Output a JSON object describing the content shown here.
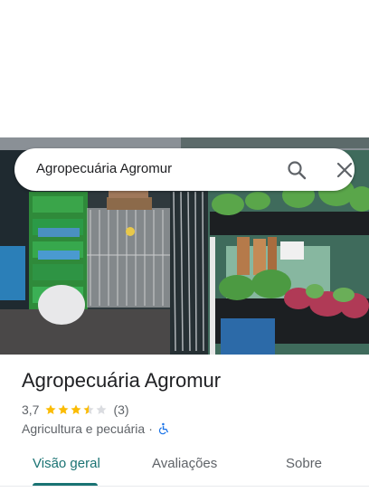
{
  "search": {
    "query": "Agropecuária Agromur"
  },
  "place": {
    "name": "Agropecuária Agromur",
    "rating": "3,7",
    "rating_value": 3.7,
    "review_count": "(3)",
    "category": "Agricultura e pecuária",
    "separator": "·"
  },
  "tabs": [
    {
      "label": "Visão geral"
    },
    {
      "label": "Avaliações"
    },
    {
      "label": "Sobre"
    }
  ],
  "colors": {
    "accent": "#1a7373",
    "star": "#fbbc04",
    "star_empty": "#dadce0",
    "accessibility": "#1a73e8"
  },
  "icons": {
    "search": "search-icon",
    "close": "close-icon",
    "accessibility": "wheelchair-icon"
  }
}
